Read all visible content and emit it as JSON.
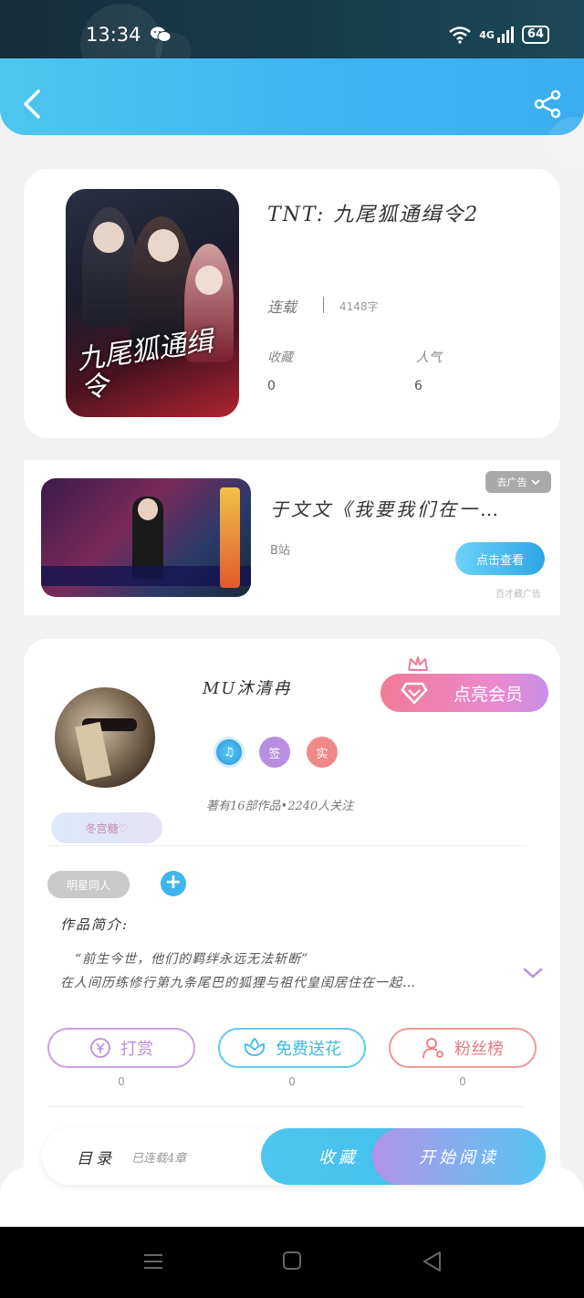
{
  "status": {
    "time": "13:34",
    "network": "4G",
    "battery": "64"
  },
  "header": {
    "back_icon": "chevron-left-icon",
    "share_icon": "share-icon"
  },
  "book": {
    "title": "TNT:  九尾狐通缉令2",
    "cover_text": "九尾狐通缉令",
    "status": "连载",
    "word_count": "4148字",
    "collect_label": "收藏",
    "collect_value": "0",
    "popularity_label": "人气",
    "popularity_value": "6"
  },
  "ad": {
    "tag": "去广告",
    "title": "于文文《我要我们在一…",
    "source": "B站",
    "button": "点击查看",
    "note": "百才藏广告"
  },
  "author": {
    "name": "MU沐清冉",
    "vip_button": "点亮会员",
    "badges": [
      {
        "icon": "music-badge-icon",
        "text": "♫"
      },
      {
        "icon": "sign-badge-icon",
        "text": "签"
      },
      {
        "icon": "real-name-badge-icon",
        "text": "实"
      }
    ],
    "stats": "著有16部作品•2240人关注",
    "fan_tag": "冬宫糖♡",
    "genre_tag": "明星同人",
    "intro_label": "作品简介:",
    "intro_lines": [
      "“前生今世，他们的羁绊永远无法斩断”",
      "在人间历练修行第九条尾巴的狐狸与祖代皇闺居住在一起…"
    ],
    "actions": [
      {
        "label": "打赏",
        "icon": "yen-icon",
        "count": "0"
      },
      {
        "label": "免费送花",
        "icon": "flower-icon",
        "count": "0"
      },
      {
        "label": "粉丝榜",
        "icon": "user-icon",
        "count": "0"
      }
    ]
  },
  "bottom": {
    "toc_label": "目录",
    "toc_sub": "已连载4章",
    "collect_button": "收藏",
    "read_button": "开始阅读"
  },
  "colors": {
    "header_blue": "#3fb3f2",
    "vip_pink": "#f27a95",
    "dashang_purple": "#c58ae0",
    "flower_cyan": "#3fc1e6",
    "fans_red": "#e87a7a"
  }
}
